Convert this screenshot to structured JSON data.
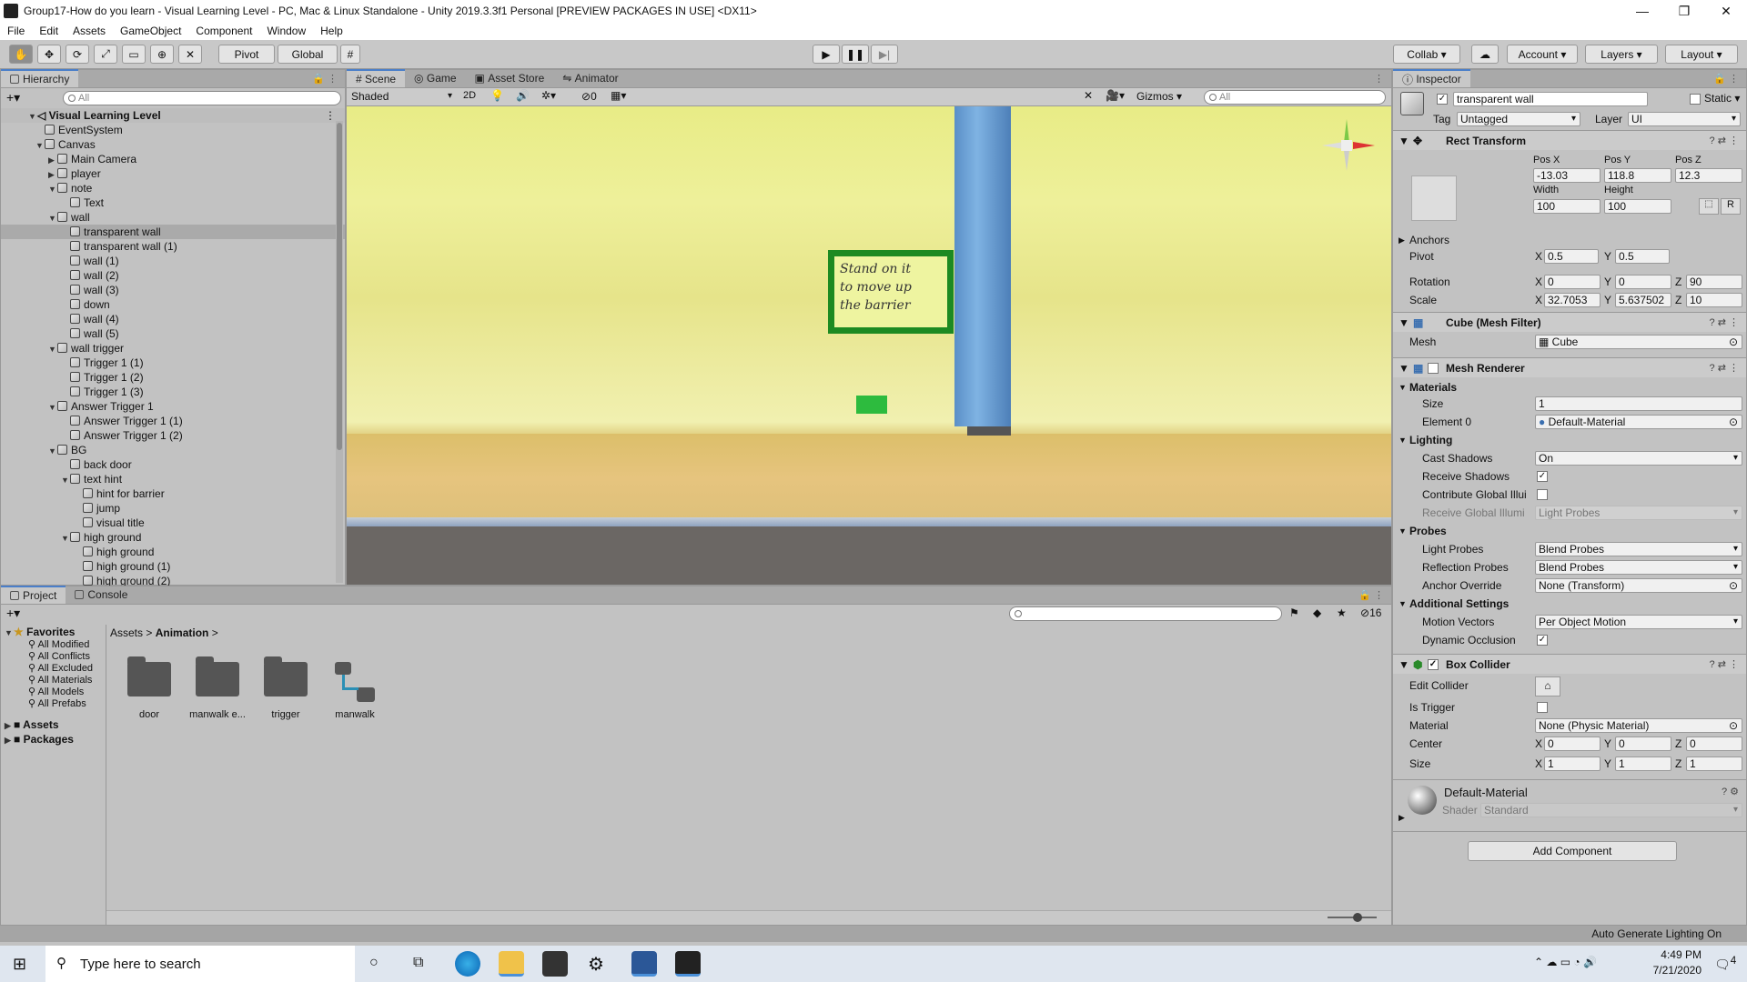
{
  "window": {
    "title": "Group17-How do you learn - Visual Learning Level - PC, Mac & Linux Standalone - Unity 2019.3.3f1 Personal [PREVIEW PACKAGES IN USE] <DX11>",
    "minimize": "—",
    "maximize": "❐",
    "close": "✕"
  },
  "menu": [
    "File",
    "Edit",
    "Assets",
    "GameObject",
    "Component",
    "Window",
    "Help"
  ],
  "toolbar": {
    "pivot": "Pivot",
    "global": "Global",
    "collab": "Collab ▾",
    "account": "Account",
    "layers": "Layers",
    "layout": "Layout"
  },
  "hierarchy": {
    "tab": "Hierarchy",
    "search_placeholder": "All",
    "root": "Visual Learning Level",
    "items": [
      {
        "label": "EventSystem",
        "depth": 1,
        "arrow": ""
      },
      {
        "label": "Canvas",
        "depth": 1,
        "arrow": "▼"
      },
      {
        "label": "Main Camera",
        "depth": 2,
        "arrow": "▶"
      },
      {
        "label": "player",
        "depth": 2,
        "arrow": "▶"
      },
      {
        "label": "note",
        "depth": 2,
        "arrow": "▼"
      },
      {
        "label": "Text",
        "depth": 3,
        "arrow": ""
      },
      {
        "label": "wall",
        "depth": 2,
        "arrow": "▼"
      },
      {
        "label": "transparent wall",
        "depth": 3,
        "arrow": "",
        "selected": true
      },
      {
        "label": "transparent wall (1)",
        "depth": 3,
        "arrow": ""
      },
      {
        "label": "wall (1)",
        "depth": 3,
        "arrow": ""
      },
      {
        "label": "wall (2)",
        "depth": 3,
        "arrow": ""
      },
      {
        "label": "wall (3)",
        "depth": 3,
        "arrow": ""
      },
      {
        "label": "down",
        "depth": 3,
        "arrow": ""
      },
      {
        "label": "wall (4)",
        "depth": 3,
        "arrow": ""
      },
      {
        "label": "wall (5)",
        "depth": 3,
        "arrow": ""
      },
      {
        "label": "wall trigger",
        "depth": 2,
        "arrow": "▼"
      },
      {
        "label": "Trigger 1 (1)",
        "depth": 3,
        "arrow": ""
      },
      {
        "label": "Trigger 1 (2)",
        "depth": 3,
        "arrow": ""
      },
      {
        "label": "Trigger 1 (3)",
        "depth": 3,
        "arrow": ""
      },
      {
        "label": "Answer Trigger 1",
        "depth": 2,
        "arrow": "▼"
      },
      {
        "label": "Answer Trigger 1 (1)",
        "depth": 3,
        "arrow": ""
      },
      {
        "label": "Answer Trigger 1 (2)",
        "depth": 3,
        "arrow": ""
      },
      {
        "label": "BG",
        "depth": 2,
        "arrow": "▼"
      },
      {
        "label": "back door",
        "depth": 3,
        "arrow": ""
      },
      {
        "label": "text hint",
        "depth": 3,
        "arrow": "▼"
      },
      {
        "label": "hint for barrier",
        "depth": 4,
        "arrow": ""
      },
      {
        "label": "jump",
        "depth": 4,
        "arrow": ""
      },
      {
        "label": "visual title",
        "depth": 4,
        "arrow": ""
      },
      {
        "label": "high ground",
        "depth": 3,
        "arrow": "▼"
      },
      {
        "label": "high ground",
        "depth": 4,
        "arrow": ""
      },
      {
        "label": "high ground (1)",
        "depth": 4,
        "arrow": ""
      },
      {
        "label": "high ground (2)",
        "depth": 4,
        "arrow": ""
      }
    ]
  },
  "scene": {
    "tabs": [
      "Scene",
      "Game",
      "Asset Store",
      "Animator"
    ],
    "shading": "Shaded",
    "mode_2d": "2D",
    "hidden_count": "0",
    "gizmos": "Gizmos",
    "search_placeholder": "All",
    "sign_text": [
      "Stand on it",
      "to move up",
      "the barrier"
    ]
  },
  "project": {
    "tabs": [
      "Project",
      "Console"
    ],
    "favorites_label": "Favorites",
    "favorites": [
      "All Modified",
      "All Conflicts",
      "All Excluded",
      "All Materials",
      "All Models",
      "All Prefabs"
    ],
    "roots": [
      "Assets",
      "Packages"
    ],
    "breadcrumb": [
      "Assets",
      "Animation"
    ],
    "hidden_count": "16",
    "items": [
      "door",
      "manwalk e...",
      "trigger",
      "manwalk"
    ]
  },
  "inspector": {
    "tab": "Inspector",
    "object_name": "transparent wall",
    "static_label": "Static",
    "tag_label": "Tag",
    "tag": "Untagged",
    "layer_label": "Layer",
    "layer": "UI",
    "rect_transform": {
      "title": "Rect Transform",
      "posx_label": "Pos X",
      "posy_label": "Pos Y",
      "posz_label": "Pos Z",
      "posx": "-13.03",
      "posy": "118.8",
      "posz": "12.3",
      "width_label": "Width",
      "height_label": "Height",
      "width": "100",
      "height": "100",
      "r_btn": "R",
      "anchors": "Anchors",
      "pivot_label": "Pivot",
      "pivot_x": "0.5",
      "pivot_y": "0.5",
      "rotation_label": "Rotation",
      "rot_x": "0",
      "rot_y": "0",
      "rot_z": "90",
      "scale_label": "Scale",
      "scale_x": "32.7053",
      "scale_y": "5.637502",
      "scale_z": "10"
    },
    "mesh_filter": {
      "title": "Cube (Mesh Filter)",
      "mesh_label": "Mesh",
      "mesh": "Cube"
    },
    "mesh_renderer": {
      "title": "Mesh Renderer",
      "materials": "Materials",
      "size_label": "Size",
      "size": "1",
      "element0_label": "Element 0",
      "element0": "Default-Material",
      "lighting": "Lighting",
      "cast_shadows_label": "Cast Shadows",
      "cast_shadows": "On",
      "receive_shadows_label": "Receive Shadows",
      "contribute_gi_label": "Contribute Global Illui",
      "receive_gi_label": "Receive Global Illumi",
      "receive_gi": "Light Probes",
      "probes": "Probes",
      "light_probes_label": "Light Probes",
      "light_probes": "Blend Probes",
      "reflection_probes_label": "Reflection Probes",
      "reflection_probes": "Blend Probes",
      "anchor_override_label": "Anchor Override",
      "anchor_override": "None (Transform)",
      "additional": "Additional Settings",
      "motion_vectors_label": "Motion Vectors",
      "motion_vectors": "Per Object Motion",
      "dynamic_occlusion_label": "Dynamic Occlusion"
    },
    "box_collider": {
      "title": "Box Collider",
      "edit_label": "Edit Collider",
      "is_trigger_label": "Is Trigger",
      "material_label": "Material",
      "material": "None (Physic Material)",
      "center_label": "Center",
      "center_x": "0",
      "center_y": "0",
      "center_z": "0",
      "size_label": "Size",
      "size_x": "1",
      "size_y": "1",
      "size_z": "1"
    },
    "material": {
      "name": "Default-Material",
      "shader_label": "Shader",
      "shader": "Standard"
    },
    "add_component": "Add Component"
  },
  "status": {
    "right": "Auto Generate Lighting On"
  },
  "taskbar": {
    "search_placeholder": "Type here to search",
    "time": "4:49 PM",
    "date": "7/21/2020",
    "notif": "4"
  },
  "colors": {
    "accent": "#4a7ec9",
    "sign_bg": "#1d8a22"
  }
}
